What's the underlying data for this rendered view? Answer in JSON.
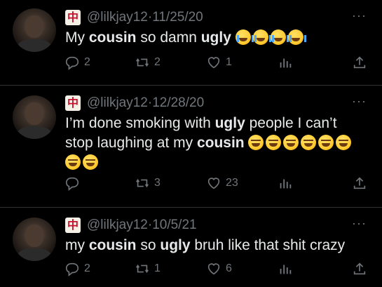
{
  "tweets": [
    {
      "handle": "@lilkjay12",
      "separator": "·",
      "date": "11/25/20",
      "badge_glyph": "中",
      "text_segments": [
        {
          "t": "My ",
          "b": false
        },
        {
          "t": "cousin",
          "b": true
        },
        {
          "t": " so damn ",
          "b": false
        },
        {
          "t": "ugly",
          "b": true
        },
        {
          "t": " ",
          "b": false
        }
      ],
      "emoji_name": "loudly-crying-face",
      "emoji_count": 4,
      "replies": "2",
      "retweets": "2",
      "likes": "1"
    },
    {
      "handle": "@lilkjay12",
      "separator": "·",
      "date": "12/28/20",
      "badge_glyph": "中",
      "text_segments": [
        {
          "t": "I’m done smoking with ",
          "b": false
        },
        {
          "t": "ugly",
          "b": true
        },
        {
          "t": " people I can’t stop laughing at my ",
          "b": false
        },
        {
          "t": "cousin",
          "b": true
        },
        {
          "t": " ",
          "b": false
        }
      ],
      "emoji_name": "face-with-tears-of-joy",
      "emoji_count": 8,
      "replies": "",
      "retweets": "3",
      "likes": "23"
    },
    {
      "handle": "@lilkjay12",
      "separator": "·",
      "date": "10/5/21",
      "badge_glyph": "中",
      "text_segments": [
        {
          "t": "my ",
          "b": false
        },
        {
          "t": "cousin",
          "b": true
        },
        {
          "t": " so ",
          "b": false
        },
        {
          "t": "ugly",
          "b": true
        },
        {
          "t": " bruh like that shit crazy",
          "b": false
        }
      ],
      "emoji_name": "",
      "emoji_count": 0,
      "replies": "2",
      "retweets": "1",
      "likes": "6"
    }
  ],
  "more_label": "···",
  "icons": [
    "reply-icon",
    "retweet-icon",
    "like-icon",
    "views-icon",
    "share-icon",
    "mahjong-badge-icon",
    "more-icon"
  ]
}
